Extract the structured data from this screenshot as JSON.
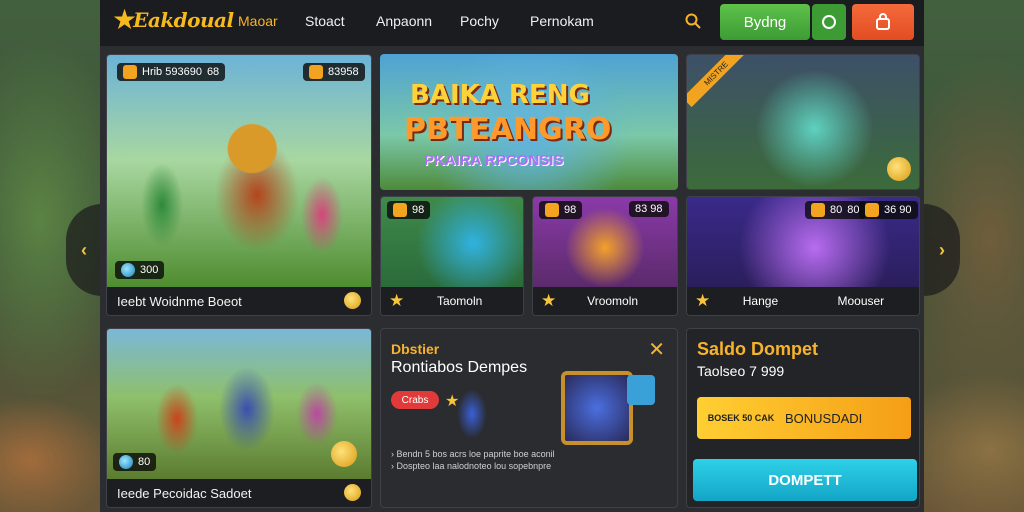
{
  "header": {
    "logo_text": "Eakdoual",
    "nav": [
      "Maoar",
      "Stoact",
      "Anpaonn",
      "Pochy",
      "Pernokam"
    ],
    "primary_button": "Bydng"
  },
  "featured": {
    "top_pill": "Hrib 593690",
    "top_pill_right": "68",
    "score_pill": "83958",
    "gem_count": "300",
    "caption": "Ieebt Woidnme Boeot"
  },
  "banner": {
    "title_line1": "BAIKA RENG",
    "title_line2": "PBTEANGRO",
    "subtitle": "PKAIRA RPCONSIS"
  },
  "corner_tile": {
    "ribbon": "MISTRE"
  },
  "tiles": [
    {
      "badge": "98",
      "label": "Taomoln"
    },
    {
      "badge": "98",
      "badge_right": "83 98",
      "label": "Vroomoln"
    },
    {
      "badge": "80",
      "badge_mid": "80",
      "badge_right": "36 90",
      "label_left": "Hange",
      "label_right": "Moouser"
    }
  ],
  "second_card": {
    "gem_count": "80",
    "caption": "Ieede Pecoidac Sadoet"
  },
  "promo": {
    "kicker": "Dbstier",
    "headline": "Rontiabos Dempes",
    "badge": "Crabs",
    "lines": [
      "Bendn 5 bos acrs loe paprite boe aconil",
      "Dospteo laa nalodnoteo lou sopebnpre"
    ]
  },
  "wallet": {
    "title": "Saldo Dompet",
    "balance": "Taolseo 7 999",
    "bonus_left": "BOSEK 50 CAK",
    "bonus_right": "BONUSDADI",
    "cta": "DOMPETT"
  },
  "colors": {
    "accent": "#f7b32b",
    "green": "#3d9b34",
    "orange": "#e24d22",
    "cyan": "#13a5c6"
  }
}
